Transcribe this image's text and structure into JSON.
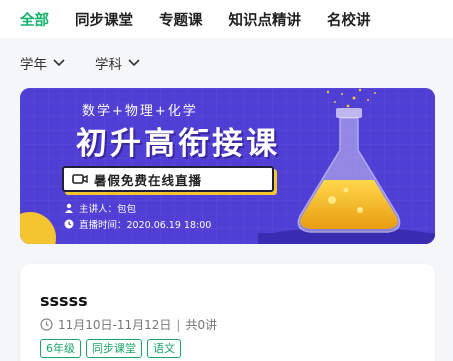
{
  "tabs": [
    {
      "label": "全部",
      "active": true
    },
    {
      "label": "同步课堂",
      "active": false
    },
    {
      "label": "专题课",
      "active": false
    },
    {
      "label": "知识点精讲",
      "active": false
    },
    {
      "label": "名校讲",
      "active": false
    }
  ],
  "filters": [
    {
      "label": "学年",
      "icon": "chevron-down-icon"
    },
    {
      "label": "学科",
      "icon": "chevron-down-icon"
    }
  ],
  "banner": {
    "subtitle": "数学+物理+化学",
    "title": "初升高衔接课",
    "live_tag": "暑假免费在线直播",
    "speaker": "主讲人：包包",
    "time": "直播时间：2020.06.19 18:00"
  },
  "course": {
    "title": "sssss",
    "date_range": "11月10日-11月12日",
    "separator": "|",
    "lessons": "共0讲",
    "tags": [
      "6年级",
      "同步课堂",
      "语文"
    ]
  },
  "colors": {
    "accent": "#12b26b",
    "banner_bg": "#4f3fd4",
    "flask_liquid": "#f5b81c"
  }
}
